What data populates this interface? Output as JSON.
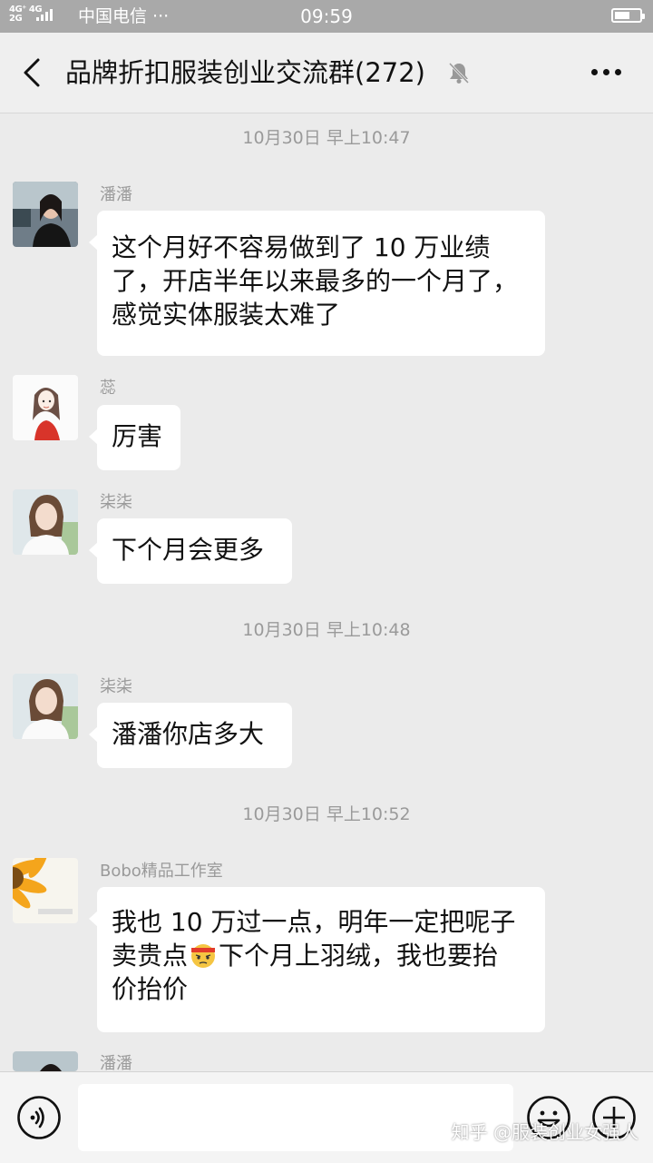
{
  "status_bar": {
    "network": "4G⁺ 4G\n2G",
    "carrier": "中国电信 ···",
    "time": "09:59",
    "battery_level": 0.6
  },
  "header": {
    "back_icon": "chevron-left-icon",
    "title": "品牌折扣服装创业交流群(272)",
    "mute_icon": "bell-muted-icon",
    "more_icon": "more-dots-icon"
  },
  "messages": [
    {
      "type": "time",
      "text": "10月30日 早上10:47"
    },
    {
      "type": "msg",
      "sender": "潘潘",
      "lines": [
        "这个月好不容易做到了 10 万业绩",
        "了，开店半年以来最多的一个月了，",
        "感觉实体服装太难了"
      ]
    },
    {
      "type": "msg",
      "sender": "蕊",
      "lines": [
        "厉害"
      ]
    },
    {
      "type": "msg",
      "sender": "柒柒",
      "lines": [
        "下个月会更多"
      ]
    },
    {
      "type": "time",
      "text": "10月30日 早上10:48"
    },
    {
      "type": "msg",
      "sender": "柒柒",
      "lines": [
        "潘潘你店多大"
      ]
    },
    {
      "type": "time",
      "text": "10月30日 早上10:52"
    },
    {
      "type": "msg",
      "sender": "Bobo精品工作室",
      "line1": "我也 10 万过一点，明年一定把呢子",
      "line2a": "卖贵点",
      "line2_emoji": "angry-headband-emoji",
      "line2b": "下个月上羽绒，我也要抬",
      "line3": "价抬价"
    },
    {
      "type": "msg",
      "sender": "潘潘",
      "lines": []
    }
  ],
  "input_bar": {
    "voice_icon": "voice-icon",
    "emoji_icon": "emoji-smile-icon",
    "plus_icon": "plus-circle-icon",
    "placeholder": ""
  },
  "watermark": "知乎 @服装创业女强人"
}
